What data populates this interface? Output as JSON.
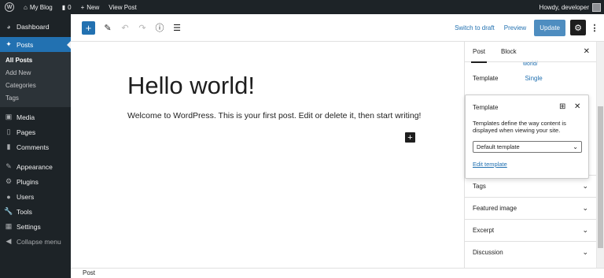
{
  "admin_bar": {
    "site_name": "My Blog",
    "comments_count": "0",
    "new_label": "New",
    "view_post_label": "View Post",
    "howdy": "Howdy, developer"
  },
  "sidebar": {
    "items": [
      {
        "label": "Dashboard",
        "icon": "dashboard-icon"
      },
      {
        "label": "Posts",
        "icon": "pin-icon"
      },
      {
        "label": "Media",
        "icon": "media-icon"
      },
      {
        "label": "Pages",
        "icon": "pages-icon"
      },
      {
        "label": "Comments",
        "icon": "comments-icon"
      },
      {
        "label": "Appearance",
        "icon": "appearance-icon"
      },
      {
        "label": "Plugins",
        "icon": "plugins-icon"
      },
      {
        "label": "Users",
        "icon": "users-icon"
      },
      {
        "label": "Tools",
        "icon": "tools-icon"
      },
      {
        "label": "Settings",
        "icon": "settings-icon"
      },
      {
        "label": "Collapse menu",
        "icon": "collapse-icon"
      }
    ],
    "posts_submenu": [
      "All Posts",
      "Add New",
      "Categories",
      "Tags"
    ]
  },
  "toolbar": {
    "switch_to_draft": "Switch to draft",
    "preview": "Preview",
    "update": "Update"
  },
  "post": {
    "title": "Hello world!",
    "paragraph": "Welcome to WordPress. This is your first post. Edit or delete it, then start writing!"
  },
  "footer": {
    "breadcrumb": "Post"
  },
  "panel": {
    "tabs": [
      "Post",
      "Block"
    ],
    "partial_value": "world/",
    "template_label": "Template",
    "template_value": "Single",
    "sections": [
      "Tags",
      "Featured image",
      "Excerpt",
      "Discussion"
    ]
  },
  "template_popover": {
    "title": "Template",
    "description": "Templates define the way content is displayed when viewing your site.",
    "selected": "Default template",
    "edit_link": "Edit template"
  },
  "colors": {
    "accent": "#2271b1",
    "admin_dark": "#1d2327"
  }
}
